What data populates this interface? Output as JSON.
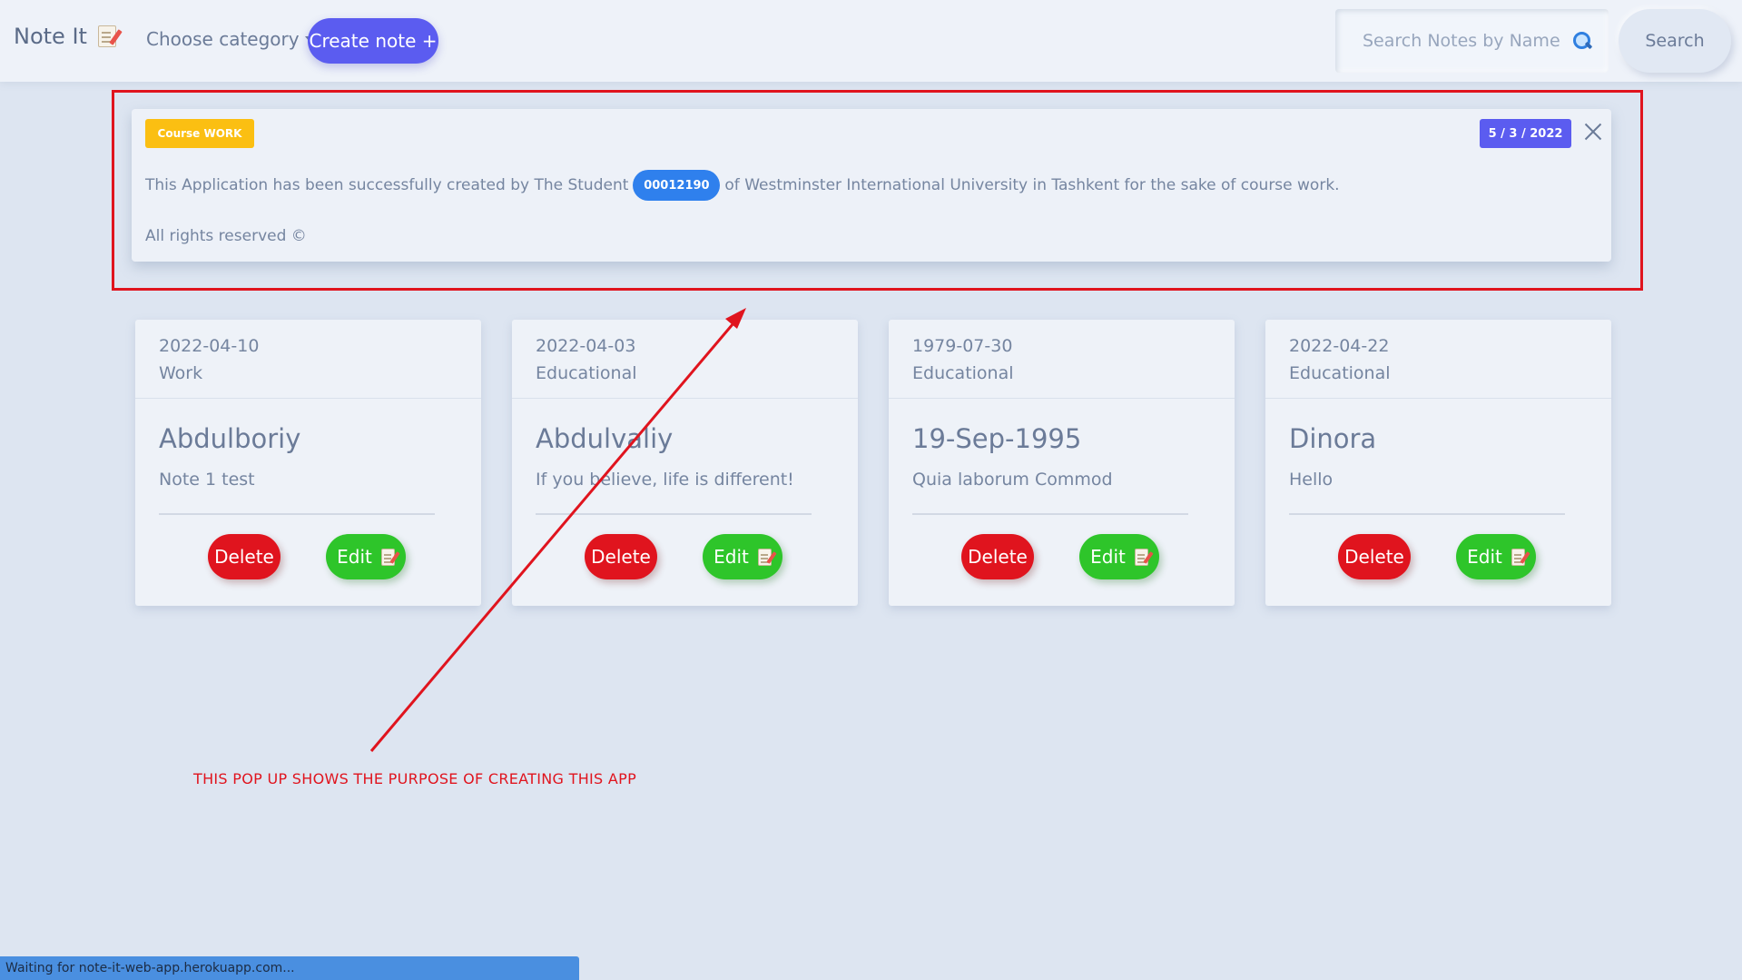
{
  "navbar": {
    "brand": "Note It",
    "category_label": "Choose category",
    "create_label": "Create note +",
    "search_placeholder": "Search Notes by Name",
    "search_button": "Search"
  },
  "popup": {
    "badge": "Course WORK",
    "date": "5 / 3 / 2022",
    "text_before": "This Application has been successfully created by The Student",
    "student_id": "00012190",
    "text_after": "of Westminster International University in Tashkent for the sake of course work.",
    "footer": "All rights reserved ©"
  },
  "notes": [
    {
      "date": "2022-04-10",
      "category": "Work",
      "title": "Abdulboriy",
      "text": "Note 1 test",
      "delete_label": "Delete",
      "edit_label": "Edit"
    },
    {
      "date": "2022-04-03",
      "category": "Educational",
      "title": "Abdulvaliy",
      "text": "If you believe, life is different!",
      "delete_label": "Delete",
      "edit_label": "Edit"
    },
    {
      "date": "1979-07-30",
      "category": "Educational",
      "title": "19-Sep-1995",
      "text": "Quia laborum Commod",
      "delete_label": "Delete",
      "edit_label": "Edit"
    },
    {
      "date": "2022-04-22",
      "category": "Educational",
      "title": "Dinora",
      "text": "Hello",
      "delete_label": "Delete",
      "edit_label": "Edit"
    }
  ],
  "annotation": {
    "note": "THIS POP UP SHOWS THE PURPOSE OF CREATING THIS APP"
  },
  "status_bar": "Waiting for note-it-web-app.herokuapp.com...",
  "colors": {
    "primary": "#5b5cf0",
    "danger": "#e0141e",
    "success": "#2ec52a",
    "warning": "#fbbf12",
    "info": "#2f80ed"
  }
}
